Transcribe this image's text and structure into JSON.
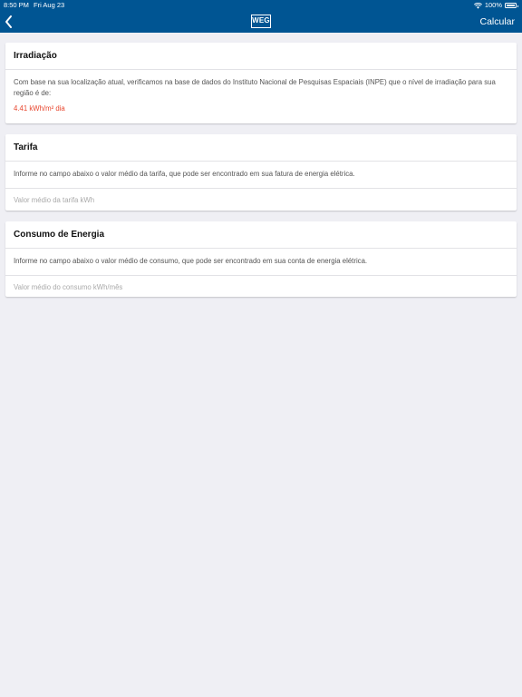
{
  "status_bar": {
    "time": "8:50 PM",
    "date": "Fri Aug 23",
    "battery": "100%"
  },
  "nav": {
    "logo_text": "WEG",
    "action_label": "Calcular"
  },
  "irradiacao": {
    "title": "Irradiação",
    "description": "Com base na sua localização atual, verificamos na base de dados do Instituto Nacional de Pesquisas Espaciais (INPE) que o nível de irradiação para sua região é de:",
    "value": "4.41 kWh/m² dia"
  },
  "tarifa": {
    "title": "Tarifa",
    "description": "Informe no campo abaixo o valor médio da tarifa, que pode ser encontrado em sua fatura de energia elétrica.",
    "placeholder": "Valor médio da tarifa kWh"
  },
  "consumo": {
    "title": "Consumo de Energia",
    "description": "Informe no campo abaixo o valor médio de consumo, que pode ser encontrado em sua conta de energia elétrica.",
    "placeholder": "Valor médio do consumo kWh/mês"
  },
  "colors": {
    "nav_bar": "#005593",
    "background": "#efeff4",
    "highlight": "#e8462e"
  }
}
